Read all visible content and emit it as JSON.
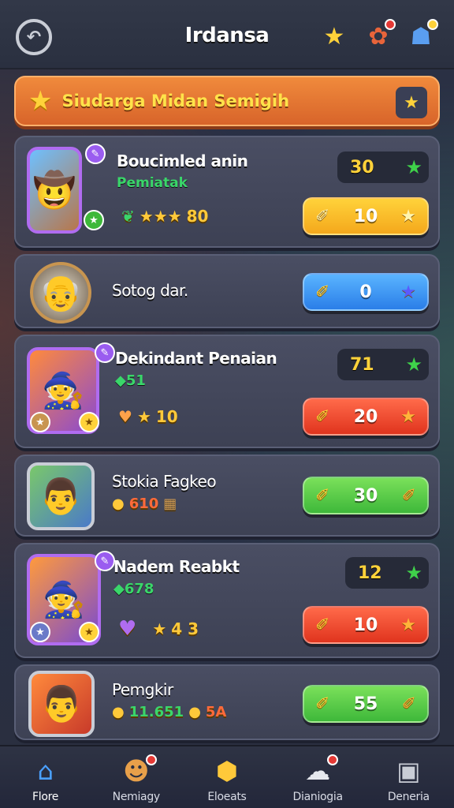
{
  "header": {
    "title": "Irdansa",
    "back_icon": "back-icon",
    "icons": [
      "star-icon",
      "gift-icon",
      "profile-icon"
    ]
  },
  "banner": {
    "text": "Siudarga Midan Semigih"
  },
  "cards": [
    {
      "name": "Boucimled anin",
      "subtitle": "Pemiatak",
      "stats": "80",
      "count": "30",
      "button": "10",
      "button_color": "yellow"
    },
    {
      "name": "Sotog dar.",
      "subtitle": "",
      "stats": "",
      "count": "",
      "button": "0",
      "button_color": "blue"
    },
    {
      "name": "Dekindant Penaian",
      "subtitle": "51",
      "stats": "10",
      "count": "71",
      "button": "20",
      "button_color": "red"
    },
    {
      "name": "Stokia Fagkeo",
      "subtitle": "",
      "stats": "610",
      "count": "",
      "button": "30",
      "button_color": "green"
    },
    {
      "name": "Nadem Reabkt",
      "subtitle": "678",
      "stats": "4 3",
      "count": "12",
      "button": "10",
      "button_color": "red"
    },
    {
      "name": "Pemgkir",
      "subtitle": "",
      "stats_a": "11.651",
      "stats_b": "5A",
      "count": "",
      "button": "55",
      "button_color": "green"
    }
  ],
  "nav": {
    "items": [
      {
        "label": "Flore",
        "icon": "home-icon"
      },
      {
        "label": "Nemiagy",
        "icon": "character-icon"
      },
      {
        "label": "Eloeats",
        "icon": "shield-icon"
      },
      {
        "label": "Dianiogia",
        "icon": "chat-icon"
      },
      {
        "label": "Deneria",
        "icon": "bag-icon"
      }
    ]
  }
}
